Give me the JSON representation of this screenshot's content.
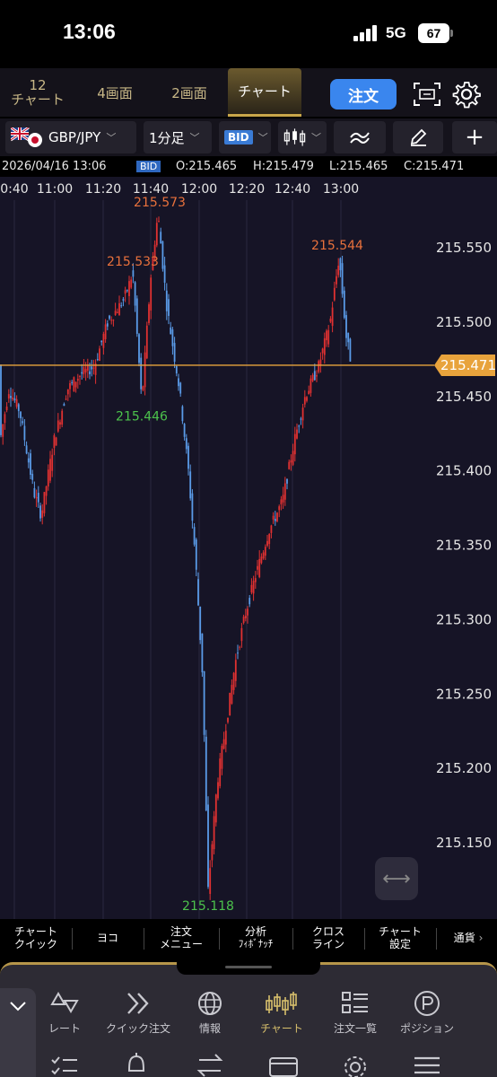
{
  "status": {
    "time": "13:06",
    "network": "5G",
    "battery": "67"
  },
  "tabs": [
    {
      "label_top": "12",
      "label_bottom": "チャート"
    },
    {
      "label": "4画面"
    },
    {
      "label": "2画面"
    },
    {
      "label": "チャート"
    }
  ],
  "order_button": "注文",
  "toolbar": {
    "symbol": "GBP/JPY",
    "timeframe": "1分足",
    "price_type": "BID"
  },
  "info": {
    "datetime": "2026/04/16 13:06",
    "bid_tag": "BID",
    "open": "O:215.465",
    "high": "H:215.479",
    "low": "L:215.465",
    "close": "C:215.471"
  },
  "chart_data": {
    "type": "candlestick",
    "x_ticks": [
      "0:40",
      "11:00",
      "11:20",
      "11:40",
      "12:00",
      "12:20",
      "12:40",
      "13:00"
    ],
    "y_ticks": [
      "215.550",
      "215.500",
      "215.450",
      "215.400",
      "215.350",
      "215.300",
      "215.250",
      "215.200",
      "215.150"
    ],
    "current_price": "215.471",
    "annotations": [
      {
        "label": "215.573",
        "kind": "high"
      },
      {
        "label": "215.533",
        "kind": "high"
      },
      {
        "label": "215.446",
        "kind": "low"
      },
      {
        "label": "215.544",
        "kind": "high"
      },
      {
        "label": "215.118",
        "kind": "low"
      }
    ],
    "colors": {
      "up": "#e03131",
      "down": "#5a9be8",
      "price_line": "#e8a33c",
      "high_label": "#e8713c",
      "low_label": "#4cc24c",
      "background": "#161426"
    }
  },
  "chart_toolbar": [
    {
      "l1": "チャート",
      "l2": "クイック"
    },
    {
      "l1": "ヨコ",
      "l2": ""
    },
    {
      "l1": "注文",
      "l2": "メニュー"
    },
    {
      "l1": "分析",
      "l2": "ﾌｨﾎﾞﾅｯﾁ"
    },
    {
      "l1": "クロス",
      "l2": "ライン"
    },
    {
      "l1": "チャート",
      "l2": "設定"
    },
    {
      "l1": "通貨",
      "l2": ""
    }
  ],
  "bottom_nav": [
    {
      "label": "レート",
      "icon": "rate-icon"
    },
    {
      "label": "クイック注文",
      "icon": "quick-order-icon"
    },
    {
      "label": "情報",
      "icon": "globe-icon"
    },
    {
      "label": "チャート",
      "icon": "candles-icon",
      "active": true
    },
    {
      "label": "注文一覧",
      "icon": "order-list-icon"
    },
    {
      "label": "ポジション",
      "icon": "position-icon"
    }
  ]
}
